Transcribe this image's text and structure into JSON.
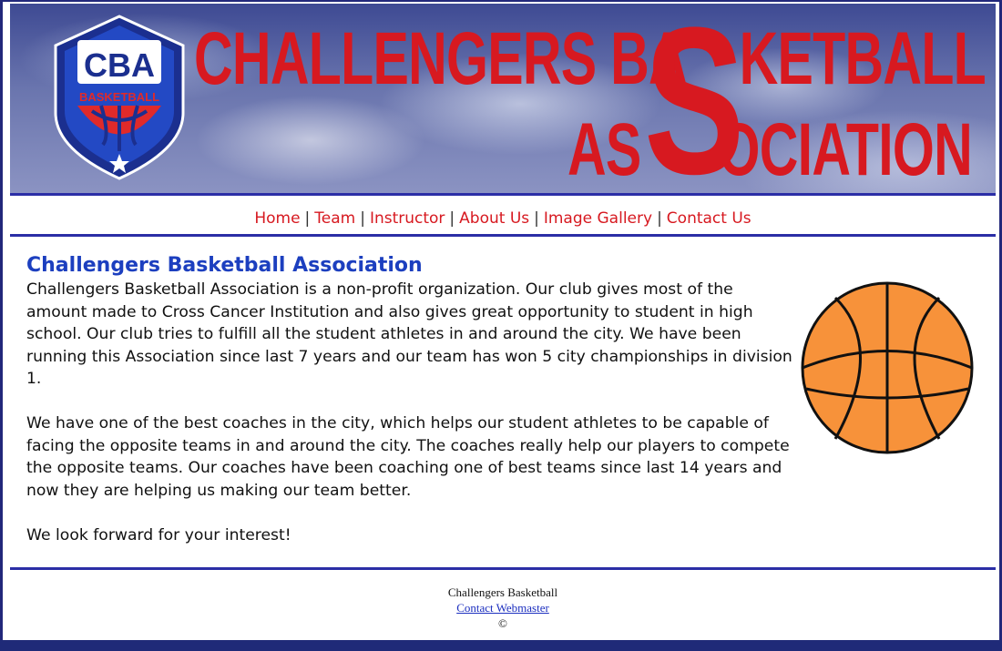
{
  "banner": {
    "logo_text": "CBA",
    "logo_sub": "BASKETBALL",
    "title_line1": "CHALLENGERS BA",
    "title_line1_end": "KETBALL",
    "title_line2": "AS",
    "title_line2_end": "OCIATION",
    "big_letter": "S"
  },
  "nav": {
    "items": [
      "Home",
      "Team",
      "Instructor",
      "About Us",
      "Image Gallery",
      "Contact Us"
    ],
    "separator": "|"
  },
  "content": {
    "heading": "Challengers Basketball Association",
    "paragraphs": [
      "Challengers Basketball Association is a non-profit organization. Our club gives most of the amount made to Cross Cancer Institution and also gives great opportunity to student in high school. Our club tries to fulfill all the student athletes in and around the city. We have been running this Association since last 7 years and our team has won 5 city championships in division 1.",
      "We have one of the best coaches in the city, which helps our student athletes to be capable of facing the opposite teams in and around the city. The coaches really help our players to compete the opposite teams. Our coaches have been coaching one of best teams since last 14 years and now they are helping us making our team better.",
      "We look forward for your interest!"
    ]
  },
  "footer": {
    "name": "Challengers Basketball",
    "link": "Contact Webmaster",
    "copyright": "©"
  },
  "colors": {
    "accent_red": "#d71920",
    "heading_blue": "#1c3fbf",
    "border_blue": "#2b2ea6",
    "ball_orange": "#f7923a"
  }
}
